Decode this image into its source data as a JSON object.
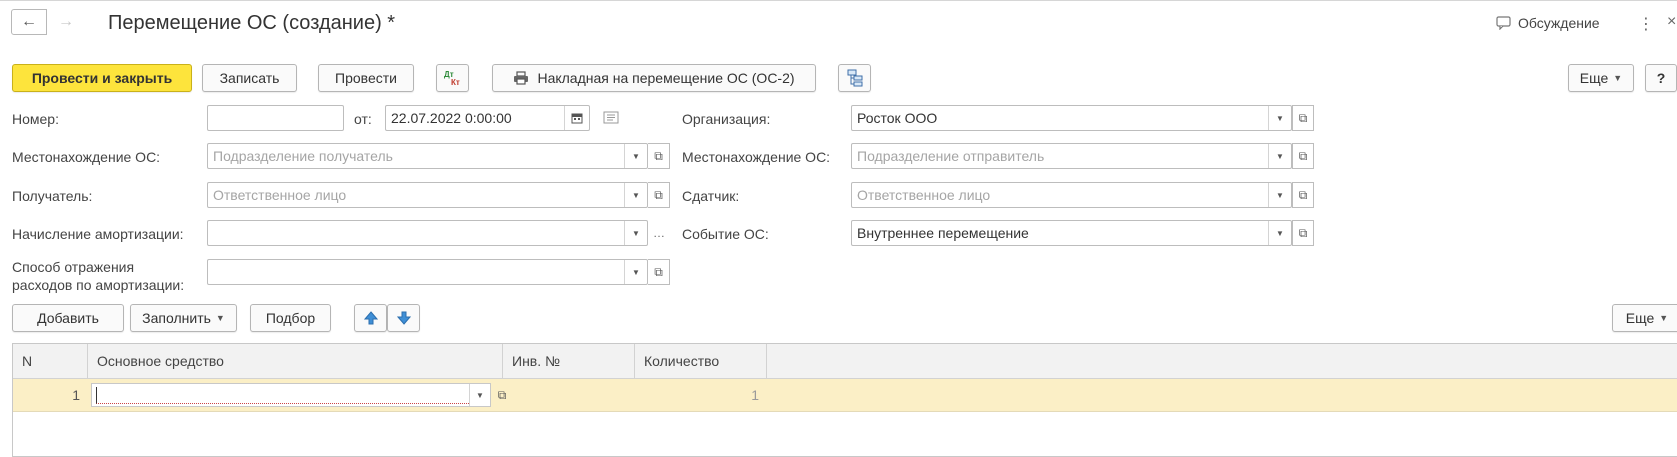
{
  "window": {
    "title": "Перемещение ОС (создание) *",
    "discussion_label": "Обсуждение",
    "more_icon": "vertical-dots-icon",
    "close_icon": "close-icon"
  },
  "toolbar": {
    "post_and_close": "Провести и закрыть",
    "save": "Записать",
    "post": "Провести",
    "dtkt_icon": "Дт\nКт",
    "invoice_print": "Накладная на перемещение ОС (ОС-2)",
    "more": "Еще",
    "help": "?"
  },
  "form": {
    "number_label": "Номер:",
    "number_value": "",
    "date_from_label": "от:",
    "date_value": "22.07.2022  0:00:00",
    "organization_label": "Организация:",
    "organization_value": "Росток ООО",
    "location_recipient_label": "Местонахождение ОС:",
    "location_recipient_placeholder": "Подразделение получатель",
    "location_sender_label": "Местонахождение ОС:",
    "location_sender_placeholder": "Подразделение отправитель",
    "recipient_label": "Получатель:",
    "recipient_placeholder": "Ответственное лицо",
    "sender_label": "Сдатчик:",
    "sender_placeholder": "Ответственное лицо",
    "depreciation_label": "Начисление амортизации:",
    "depreciation_value": "",
    "event_label": "Событие ОС:",
    "event_value": "Внутреннее перемещение",
    "expense_method_label_1": "Способ отражения",
    "expense_method_label_2": "расходов по амортизации:",
    "expense_method_value": ""
  },
  "table_toolbar": {
    "add": "Добавить",
    "fill": "Заполнить",
    "select": "Подбор",
    "more": "Еще"
  },
  "table": {
    "columns": [
      "N",
      "Основное средство",
      "Инв. №",
      "Количество"
    ],
    "rows": [
      {
        "n": "1",
        "asset": "",
        "inv": "",
        "qty": "1"
      }
    ]
  },
  "colors": {
    "primary_button": "#fde43c",
    "selected_row": "#fbefc6",
    "arrow_blue": "#3f8fd6"
  }
}
